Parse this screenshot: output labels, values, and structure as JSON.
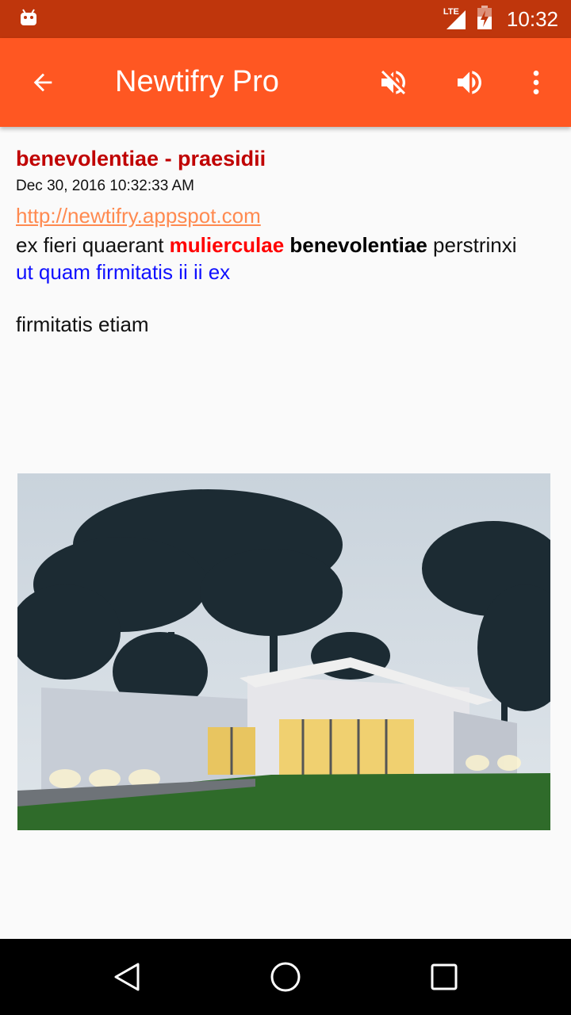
{
  "status_bar": {
    "network": "LTE",
    "time": "10:32",
    "icons": [
      "android-icon",
      "signal-icon",
      "battery-charging-icon"
    ]
  },
  "app_bar": {
    "title": "Newtifry Pro",
    "icons": [
      "back-arrow-icon",
      "mute-icon",
      "volume-icon",
      "overflow-menu-icon"
    ],
    "color": "#ff5722"
  },
  "message": {
    "title": "benevolentiae - praesidii",
    "date": "Dec 30, 2016 10:32:33 AM",
    "link": "http://newtifry.appspot.com",
    "line1": {
      "part1": "ex fieri quaerant ",
      "red_bold": "mulierculae",
      "part2": " ",
      "black_bold": "benevolentiae",
      "part3": " perstrinxi"
    },
    "line2_blue": "ut quam firmitatis ii ii ex",
    "extra": "firmitatis etiam"
  },
  "image": {
    "description_icon": "house-photo"
  },
  "nav_bar": {
    "icons": [
      "back-triangle-icon",
      "home-circle-icon",
      "recents-square-icon"
    ]
  }
}
